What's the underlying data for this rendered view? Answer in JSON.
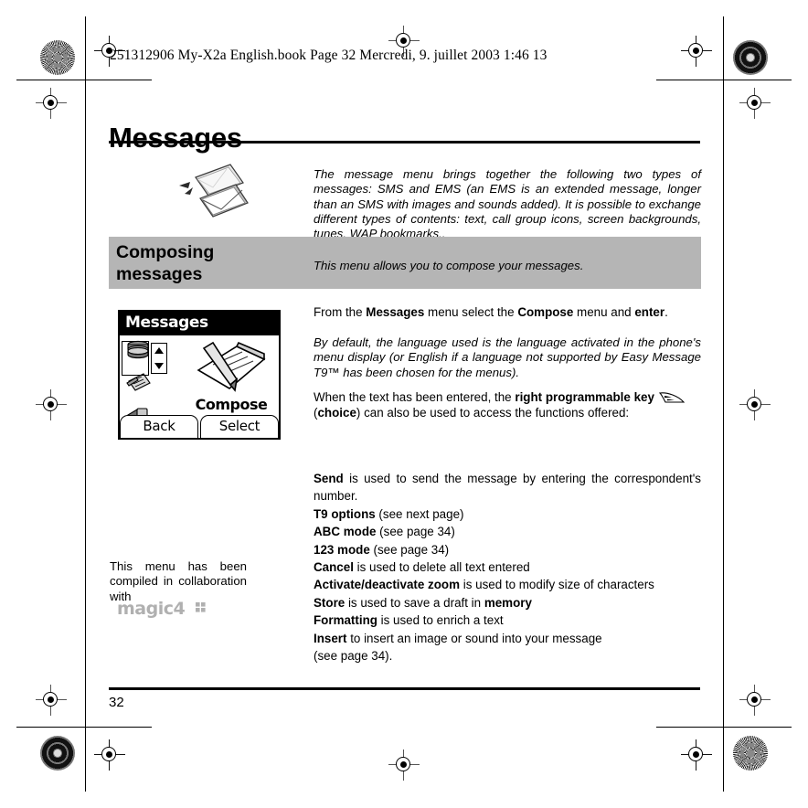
{
  "print_header": "251312906 My-X2a English.book  Page 32  Mercredi, 9. juillet 2003  1:46 13",
  "title": "Messages",
  "intro": "The message menu brings together the following two types of messages: SMS and EMS (an EMS is an extended message, longer than an SMS with images and sounds added). It is possible to exchange different types of contents: text, call group icons, screen backgrounds, tunes, WAP bookmarks..",
  "section": {
    "heading": "Composing messages",
    "description": "This menu allows you to compose your messages."
  },
  "phone_screen": {
    "title": "Messages",
    "selected_label": "Compose",
    "softkey_left": "Back",
    "softkey_right": "Select"
  },
  "body": {
    "intro_line_pre": "From the ",
    "intro_line_b1": "Messages",
    "intro_line_mid": " menu select the ",
    "intro_line_b2": "Compose",
    "intro_line_mid2": " menu and ",
    "intro_line_b3": "enter",
    "intro_line_end": ".",
    "default_language_note": "By default, the language used is  the language activated in the phone's menu display (or English if a language not supported by Easy Message T9™ has been chosen for the menus).",
    "right_key_pre": "When the text has been entered, the ",
    "right_key_bold": "right programmable key",
    "right_key_post_pre": "(",
    "right_key_post_bold": "choice",
    "right_key_post_end": ") can also be used to access the functions offered:"
  },
  "functions": [
    {
      "term": "Send",
      "rest": " is used to send the message by entering the correspondent's number."
    },
    {
      "term": "T9 options",
      "rest": " (see next page)"
    },
    {
      "term": "ABC mode",
      "rest": " (see page 34)"
    },
    {
      "term": "123 mode",
      "rest": " (see page 34)"
    },
    {
      "term": "Cancel",
      "rest": " is used to delete all text entered"
    },
    {
      "term": "Activate/deactivate zoom",
      "rest": " is used to modify size of characters"
    },
    {
      "term": "Store",
      "rest": " is used to save a draft in ",
      "rest_bold": "memory"
    },
    {
      "term": "Formatting",
      "rest": " is used to enrich a text"
    },
    {
      "term": "Insert",
      "rest": " to insert an image or sound into your message"
    },
    {
      "term": "",
      "rest": "(see page 34)."
    }
  ],
  "side_note": "This menu has been compiled in collaboration with",
  "logo_text": "magic4",
  "footer": {
    "page_number": "32"
  },
  "colors": {
    "section_bar": "#b5b5b5",
    "logo_gray": "#b0b0b0",
    "ink": "#000000"
  }
}
